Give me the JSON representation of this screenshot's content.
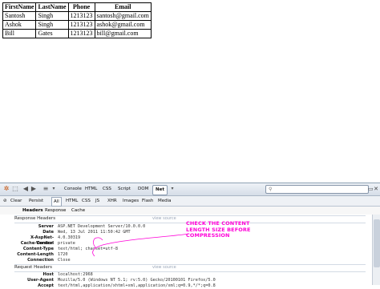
{
  "table": {
    "headers": [
      "FirstName",
      "LastName",
      "Phone",
      "Email"
    ],
    "rows": [
      [
        "Santosh",
        "Singh",
        "1213123",
        "santosh@gmail.com"
      ],
      [
        "Ashok",
        "Singh",
        "1213123",
        "ashok@gmail.com"
      ],
      [
        "Bill",
        "Gates",
        "1213123",
        "bill@gmail.com"
      ]
    ]
  },
  "firebug": {
    "toolbar": {
      "tabs": [
        "Console",
        "HTML",
        "CSS",
        "Script",
        "DOM",
        "Net"
      ],
      "selected_tab": "Net"
    },
    "subbar": [
      "Clear",
      "Persist",
      "All",
      "HTML",
      "CSS",
      "JS",
      "XHR",
      "Images",
      "Flash",
      "Media"
    ],
    "request_tabs": [
      "Headers",
      "Response",
      "Cache"
    ],
    "response_headers_title": "Response Headers",
    "request_headers_title": "Request Headers",
    "view_source": "view source",
    "response_headers": [
      {
        "name": "Server",
        "value": "ASP.NET Development Server/10.0.0.0"
      },
      {
        "name": "Date",
        "value": "Wed, 13 Jul 2011 11:50:42 GMT"
      },
      {
        "name": "X-AspNet-Version",
        "value": "4.0.30319"
      },
      {
        "name": "Cache-Control",
        "value": "private"
      },
      {
        "name": "Content-Type",
        "value": "text/html; charset=utf-8"
      },
      {
        "name": "Content-Length",
        "value": "1720"
      },
      {
        "name": "Connection",
        "value": "Close"
      }
    ],
    "request_headers": [
      {
        "name": "Host",
        "value": "localhost:2968"
      },
      {
        "name": "User-Agent",
        "value": "Mozilla/5.0 (Windows NT 5.1; rv:5.0) Gecko/20100101 Firefox/5.0"
      },
      {
        "name": "Accept",
        "value": "text/html,application/xhtml+xml,application/xml;q=0.9,*/*;q=0.8"
      }
    ]
  },
  "annotation": {
    "text": "CHECK THE CONTENT LENGTH SIZE BEFORE COMPRESSION",
    "color": "#ff00d8"
  }
}
